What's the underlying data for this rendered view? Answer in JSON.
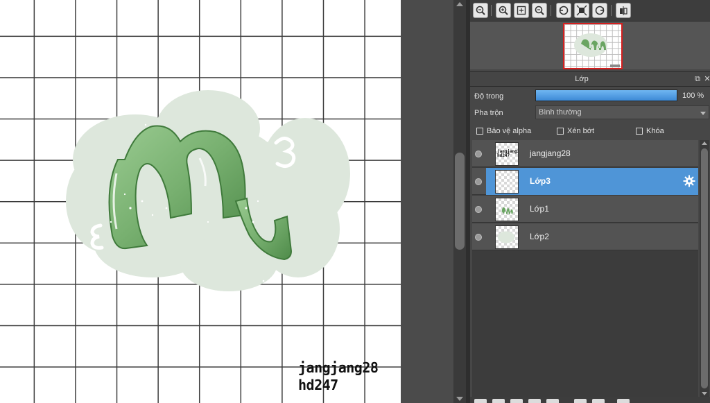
{
  "canvas": {
    "signature_line1": "jangjang28",
    "signature_line2": "hd247",
    "colors": {
      "ribbon": "#7bb574",
      "ribbon_dark": "#4e8a4a",
      "cloud": "#dde7dc",
      "grid": "#3c3c3c"
    }
  },
  "toolbar": {
    "buttons": [
      "zoom-fit-icon",
      "zoom-in-icon",
      "fit-window-icon",
      "zoom-out-icon",
      "rotate-left-icon",
      "actual-size-icon",
      "rotate-right-icon",
      "flip-icon"
    ]
  },
  "layers_panel": {
    "title": "Lớp",
    "opacity_label": "Độ trong",
    "opacity_value": "100 %",
    "opacity_fraction": 1.0,
    "blend_label": "Pha trộn",
    "blend_value": "Bình thường",
    "checkboxes": [
      {
        "label": "Bảo vệ alpha",
        "checked": false
      },
      {
        "label": "Xén bớt",
        "checked": false
      },
      {
        "label": "Khóa",
        "checked": false
      }
    ],
    "layers": [
      {
        "name": "jangjang28",
        "visible": true,
        "selected": false,
        "thumb_text1": "jangjang28",
        "thumb_text2": "hd247"
      },
      {
        "name": "Lớp3",
        "visible": true,
        "selected": true
      },
      {
        "name": "Lớp1",
        "visible": true,
        "selected": false
      },
      {
        "name": "Lớp2",
        "visible": true,
        "selected": false
      }
    ],
    "accent_color": "#4f95d7"
  }
}
